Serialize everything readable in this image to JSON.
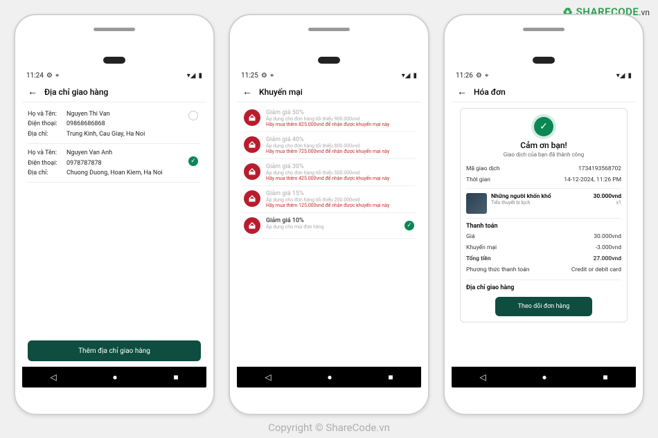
{
  "watermarks": {
    "logo_text": "SHARECODE",
    "logo_suffix": ".vn",
    "url": "ShareCode.vn",
    "copyright": "Copyright © ShareCode.vn"
  },
  "screen1": {
    "status_time": "11:24",
    "title": "Địa chỉ giao hàng",
    "addresses": [
      {
        "rows": [
          {
            "label": "Họ và Tên:",
            "value": "Nguyen Thi Van"
          },
          {
            "label": "Điện thoại:",
            "value": "09868686868"
          },
          {
            "label": "Địa chỉ:",
            "value": "Trung Kinh, Cau Giay, Ha Noi"
          }
        ],
        "selected": false
      },
      {
        "rows": [
          {
            "label": "Họ và Tên:",
            "value": "Nguyen Van Anh"
          },
          {
            "label": "Điện thoại:",
            "value": "0978787878"
          },
          {
            "label": "Địa chỉ:",
            "value": "Chuong Duong, Hoan Kiem, Ha Noi"
          }
        ],
        "selected": true
      }
    ],
    "add_button": "Thêm địa chỉ giao hàng"
  },
  "screen2": {
    "status_time": "11:25",
    "title": "Khuyến mại",
    "promos": [
      {
        "title": "Giảm giá 50%",
        "sub": "Áp dụng cho đơn hàng tối thiểu 900.000vnd",
        "warn": "Hãy mua thêm 825.000vnd để nhận được khuyến mại này",
        "disabled": true
      },
      {
        "title": "Giảm giá 40%",
        "sub": "Áp dụng cho đơn hàng tối thiểu 800.000vnd",
        "warn": "Hãy mua thêm 725.000vnd để nhận được khuyến mại này",
        "disabled": true
      },
      {
        "title": "Giảm giá 30%",
        "sub": "Áp dụng cho đơn hàng tối thiểu 500.000vnd",
        "warn": "Hãy mua thêm 425.000vnd để nhận được khuyến mại này",
        "disabled": true
      },
      {
        "title": "Giảm giá 15%",
        "sub": "Áp dụng cho đơn hàng tối thiểu 200.000vnd",
        "warn": "Hãy mua thêm 125.000vnd để nhận được khuyến mại này",
        "disabled": true
      },
      {
        "title": "Giảm giá 10%",
        "sub": "Áp dụng cho mọi đơn hàng",
        "warn": "",
        "disabled": false,
        "selected": true
      }
    ]
  },
  "screen3": {
    "status_time": "11:26",
    "title": "Hóa đơn",
    "thank_title": "Cảm ơn bạn!",
    "thank_sub": "Giao dịch của bạn đã thành công",
    "rows_top": [
      {
        "label": "Mã giao dịch",
        "value": "1734193568702"
      },
      {
        "label": "Thời gian",
        "value": "14-12-2024, 11:26 PM"
      }
    ],
    "item": {
      "title": "Những người khốn khổ",
      "sub": "Tiểu thuyết bi kịch",
      "price": "30.000vnd",
      "qty": "x1"
    },
    "payment_title": "Thanh toán",
    "payment_rows": [
      {
        "label": "Giá",
        "value": "30.000vnd"
      },
      {
        "label": "Khuyến mại",
        "value": "-3.000vnd"
      },
      {
        "label": "Tổng tiền",
        "value": "27.000vnd",
        "bold": true
      },
      {
        "label": "Phương thức thanh toán",
        "value": "Credit or debit card"
      }
    ],
    "shipping_title": "Địa chỉ giao hàng",
    "track_button": "Theo dõi đơn hàng"
  }
}
